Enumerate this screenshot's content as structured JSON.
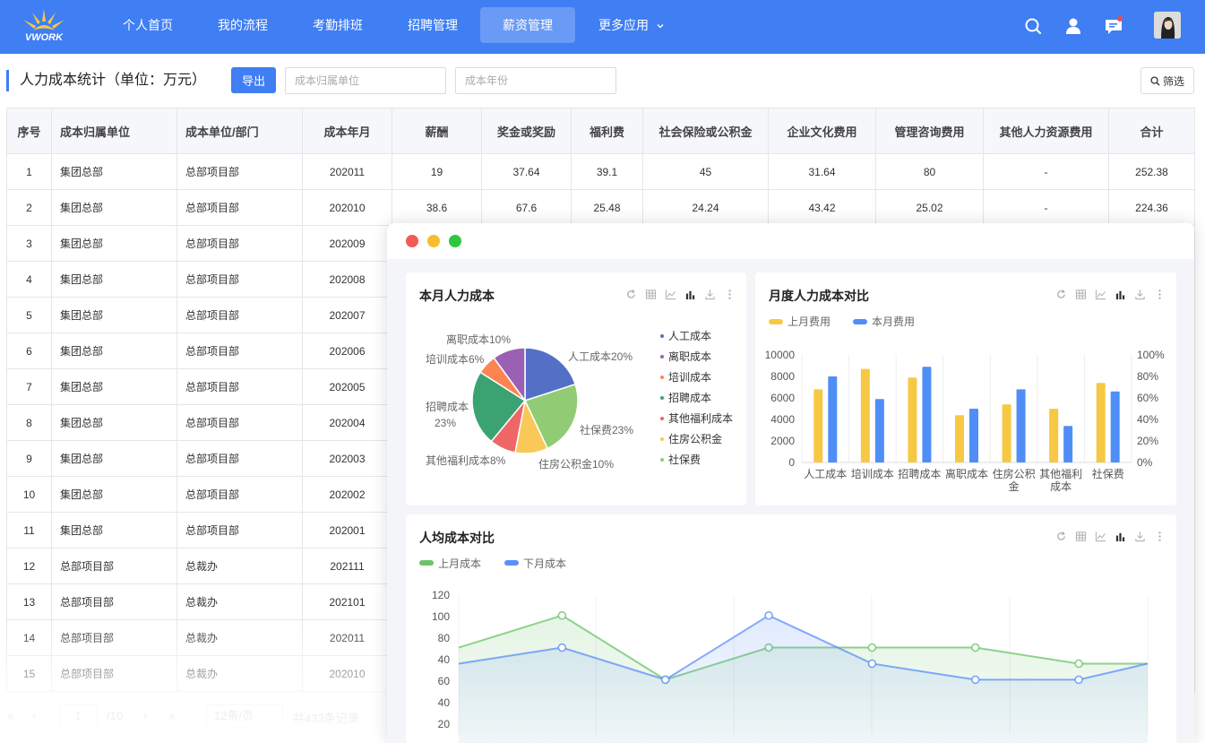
{
  "header": {
    "logo_text": "VWORK",
    "nav": [
      {
        "label": "个人首页"
      },
      {
        "label": "我的流程"
      },
      {
        "label": "考勤排班"
      },
      {
        "label": "招聘管理"
      },
      {
        "label": "薪资管理",
        "active": true
      },
      {
        "label": "更多应用"
      }
    ],
    "icons": [
      "search-icon",
      "user-icon",
      "message-icon",
      "avatar"
    ],
    "accent_color": "#3f7ef3"
  },
  "toolbar": {
    "title": "人力成本统计（单位：万元）",
    "export_label": "导出",
    "unit_placeholder": "成本归属单位",
    "year_placeholder": "成本年份",
    "filter_label": "筛选"
  },
  "table": {
    "columns": [
      "序号",
      "成本归属单位",
      "成本单位/部门",
      "成本年月",
      "薪酬",
      "奖金或奖励",
      "福利费",
      "社会保险或公积金",
      "企业文化费用",
      "管理咨询费用",
      "其他人力资源费用",
      "合计"
    ],
    "rows": [
      [
        "1",
        "集团总部",
        "总部项目部",
        "202011",
        "19",
        "37.64",
        "39.1",
        "45",
        "31.64",
        "80",
        "-",
        "252.38"
      ],
      [
        "2",
        "集团总部",
        "总部项目部",
        "202010",
        "38.6",
        "67.6",
        "25.48",
        "24.24",
        "43.42",
        "25.02",
        "-",
        "224.36"
      ],
      [
        "3",
        "集团总部",
        "总部项目部",
        "202009"
      ],
      [
        "4",
        "集团总部",
        "总部项目部",
        "202008"
      ],
      [
        "5",
        "集团总部",
        "总部项目部",
        "202007"
      ],
      [
        "6",
        "集团总部",
        "总部项目部",
        "202006"
      ],
      [
        "7",
        "集团总部",
        "总部项目部",
        "202005"
      ],
      [
        "8",
        "集团总部",
        "总部项目部",
        "202004"
      ],
      [
        "9",
        "集团总部",
        "总部项目部",
        "202003"
      ],
      [
        "10",
        "集团总部",
        "总部项目部",
        "202002"
      ],
      [
        "11",
        "集团总部",
        "总部项目部",
        "202001"
      ],
      [
        "12",
        "总部项目部",
        "总裁办",
        "202111"
      ],
      [
        "13",
        "总部项目部",
        "总裁办",
        "202101"
      ],
      [
        "14",
        "总部项目部",
        "总裁办",
        "202011"
      ],
      [
        "15",
        "总部项目部",
        "总裁办",
        "202010"
      ]
    ]
  },
  "pager": {
    "current_page": "1",
    "total_pages": "/10",
    "page_size": "12条/页",
    "total_records": "共433条记录"
  },
  "dashboard": {
    "window_dots": [
      "#f25c55",
      "#f7bd2e",
      "#2ec840"
    ],
    "cards": {
      "pie_title": "本月人力成本",
      "bar_title": "月度人力成本对比",
      "line_title": "人均成本对比"
    }
  },
  "chart_data": [
    {
      "type": "pie",
      "title": "本月人力成本",
      "slices": [
        {
          "label": "人工成本",
          "value": 20,
          "color": "#5470c6",
          "callout": "人工成本20%"
        },
        {
          "label": "社保费",
          "value": 23,
          "color": "#91cc75",
          "callout": "社保费23%"
        },
        {
          "label": "住房公积金",
          "value": 10,
          "color": "#fac858",
          "callout": "住房公积金10%"
        },
        {
          "label": "其他福利成本",
          "value": 8,
          "color": "#ee6666",
          "callout": "其他福利成本8%"
        },
        {
          "label": "招聘成本",
          "value": 23,
          "color": "#3ba272",
          "callout": "招聘成本23%"
        },
        {
          "label": "培训成本",
          "value": 6,
          "color": "#fc8452",
          "callout": "培训成本6%"
        },
        {
          "label": "离职成本",
          "value": 10,
          "color": "#9a60b4",
          "callout": "离职成本10%"
        }
      ],
      "legend": [
        {
          "label": "人工成本",
          "color": "#5470c6"
        },
        {
          "label": "离职成本",
          "color": "#9a60b4"
        },
        {
          "label": "培训成本",
          "color": "#fc8452"
        },
        {
          "label": "招聘成本",
          "color": "#3ba272"
        },
        {
          "label": "其他福利成本",
          "color": "#ee6666"
        },
        {
          "label": "住房公积金",
          "color": "#fac858"
        },
        {
          "label": "社保费",
          "color": "#91cc75"
        }
      ],
      "legend_position": "right"
    },
    {
      "type": "bar",
      "title": "月度人力成本对比",
      "categories": [
        "人工成本",
        "培训成本",
        "招聘成本",
        "离职成本",
        "住房公积金",
        "其他福利成本",
        "社保费"
      ],
      "series": [
        {
          "name": "上月费用",
          "color": "#f7c843",
          "values": [
            6800,
            8700,
            7900,
            4400,
            5400,
            5000,
            7400
          ]
        },
        {
          "name": "本月费用",
          "color": "#4f8ef7",
          "values": [
            8000,
            5900,
            8900,
            5000,
            6800,
            3400,
            6600
          ]
        }
      ],
      "ylim": [
        0,
        10000
      ],
      "yticks": [
        "0",
        "2000",
        "4000",
        "6000",
        "8000",
        "10000"
      ],
      "y2ticks": [
        "0%",
        "20%",
        "40%",
        "60%",
        "80%",
        "100%"
      ],
      "legend_position": "top-left",
      "grid": "vertical"
    },
    {
      "type": "area",
      "title": "人均成本对比",
      "series": [
        {
          "name": "上月成本",
          "color": "#6cc36a",
          "values": [
            65,
            85,
            45,
            65,
            65,
            65,
            55,
            55
          ]
        },
        {
          "name": "下月成本",
          "color": "#5b8ff9",
          "values": [
            55,
            65,
            45,
            85,
            55,
            45,
            45,
            55
          ]
        }
      ],
      "yticks": [
        "120",
        "100",
        "80",
        "40",
        "60",
        "40",
        "20"
      ],
      "legend_position": "top-left",
      "grid": "vertical"
    }
  ]
}
